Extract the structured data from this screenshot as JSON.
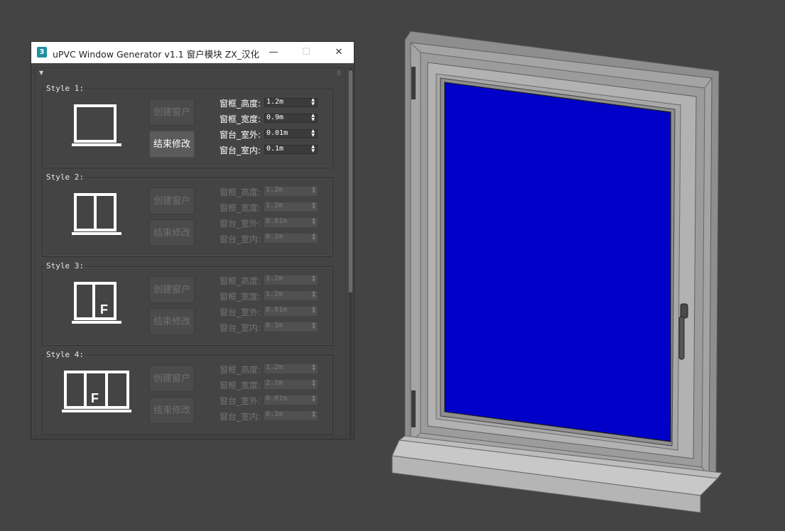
{
  "window": {
    "title": "uPVC Window Generator v1.1 窗户模块 ZX_汉化",
    "app_icon_glyph": "3",
    "minimize_glyph": "—",
    "maximize_glyph": "☐",
    "close_glyph": "✕"
  },
  "rollout": {
    "collapse_glyph": "▼",
    "grip_glyph": "⠿"
  },
  "styles": [
    {
      "title": "Style 1:",
      "create_label": "创建窗户",
      "finish_label": "结束修改",
      "enabled": true,
      "params": [
        {
          "label": "窗框_高度:",
          "value": "1.2m"
        },
        {
          "label": "窗框_宽度:",
          "value": "0.9m"
        },
        {
          "label": "窗台_室外:",
          "value": "0.01m"
        },
        {
          "label": "窗台_室内:",
          "value": "0.1m"
        }
      ]
    },
    {
      "title": "Style 2:",
      "create_label": "创建窗户",
      "finish_label": "结束修改",
      "enabled": false,
      "params": [
        {
          "label": "窗框_高度:",
          "value": "1.2m"
        },
        {
          "label": "窗框_宽度:",
          "value": "1.2m"
        },
        {
          "label": "窗台_室外:",
          "value": "0.01m"
        },
        {
          "label": "窗台_室内:",
          "value": "0.1m"
        }
      ]
    },
    {
      "title": "Style 3:",
      "create_label": "创建窗户",
      "finish_label": "结束修改",
      "enabled": false,
      "icon_letter": "F",
      "params": [
        {
          "label": "窗框_高度:",
          "value": "1.2m"
        },
        {
          "label": "窗框_宽度:",
          "value": "1.2m"
        },
        {
          "label": "窗台_室外:",
          "value": "0.01m"
        },
        {
          "label": "窗台_室内:",
          "value": "0.1m"
        }
      ]
    },
    {
      "title": "Style 4:",
      "create_label": "创建窗户",
      "finish_label": "结束修改",
      "enabled": false,
      "icon_letter": "F",
      "params": [
        {
          "label": "窗框_高度:",
          "value": "1.2m"
        },
        {
          "label": "窗框_宽度:",
          "value": "2.1m"
        },
        {
          "label": "窗台_室外:",
          "value": "0.01m"
        },
        {
          "label": "窗台_室内:",
          "value": "0.1m"
        }
      ]
    }
  ],
  "spinner_glyph": "▲▼",
  "colors": {
    "viewport_bg": "#444444",
    "glass": "#0000c8",
    "frame_light": "#a9a9a9",
    "frame_dark": "#7d7d7d",
    "ui_bg": "#444444"
  }
}
